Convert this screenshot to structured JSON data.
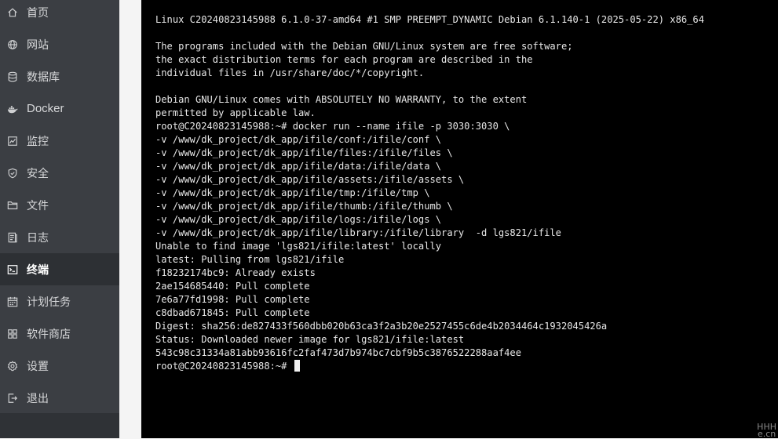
{
  "sidebar": {
    "items": [
      {
        "label": "首页",
        "icon": "home-icon",
        "active": false
      },
      {
        "label": "网站",
        "icon": "globe-icon",
        "active": false
      },
      {
        "label": "数据库",
        "icon": "database-icon",
        "active": false
      },
      {
        "label": "Docker",
        "icon": "docker-icon",
        "active": false
      },
      {
        "label": "监控",
        "icon": "monitor-icon",
        "active": false
      },
      {
        "label": "安全",
        "icon": "shield-icon",
        "active": false
      },
      {
        "label": "文件",
        "icon": "folder-icon",
        "active": false
      },
      {
        "label": "日志",
        "icon": "log-icon",
        "active": false
      },
      {
        "label": "终端",
        "icon": "terminal-icon",
        "active": true
      },
      {
        "label": "计划任务",
        "icon": "calendar-icon",
        "active": false
      },
      {
        "label": "软件商店",
        "icon": "apps-grid-icon",
        "active": false
      },
      {
        "label": "设置",
        "icon": "gear-icon",
        "active": false
      },
      {
        "label": "退出",
        "icon": "logout-icon",
        "active": false
      }
    ]
  },
  "terminal": {
    "lines": [
      "Linux C20240823145988 6.1.0-37-amd64 #1 SMP PREEMPT_DYNAMIC Debian 6.1.140-1 (2025-05-22) x86_64",
      "",
      "The programs included with the Debian GNU/Linux system are free software;",
      "the exact distribution terms for each program are described in the",
      "individual files in /usr/share/doc/*/copyright.",
      "",
      "Debian GNU/Linux comes with ABSOLUTELY NO WARRANTY, to the extent",
      "permitted by applicable law.",
      "root@C20240823145988:~# docker run --name ifile -p 3030:3030 \\",
      "-v /www/dk_project/dk_app/ifile/conf:/ifile/conf \\",
      "-v /www/dk_project/dk_app/ifile/files:/ifile/files \\",
      "-v /www/dk_project/dk_app/ifile/data:/ifile/data \\",
      "-v /www/dk_project/dk_app/ifile/assets:/ifile/assets \\",
      "-v /www/dk_project/dk_app/ifile/tmp:/ifile/tmp \\",
      "-v /www/dk_project/dk_app/ifile/thumb:/ifile/thumb \\",
      "-v /www/dk_project/dk_app/ifile/logs:/ifile/logs \\",
      "-v /www/dk_project/dk_app/ifile/library:/ifile/library  -d lgs821/ifile",
      "Unable to find image 'lgs821/ifile:latest' locally",
      "latest: Pulling from lgs821/ifile",
      "f18232174bc9: Already exists",
      "2ae154685440: Pull complete",
      "7e6a77fd1998: Pull complete",
      "c8dbad671845: Pull complete",
      "Digest: sha256:de827433f560dbb020b63ca3f2a3b20e2527455c6de4b2034464c1932045426a",
      "Status: Downloaded newer image for lgs821/ifile:latest",
      "543c98c31334a81abb93616fc2faf473d7b974bc7cbf9b5c3876522288aaf4ee"
    ],
    "prompt": "root@C20240823145988:~# "
  },
  "watermark": {
    "line1": "HHH",
    "line2": "e.cn"
  },
  "colors": {
    "sidebar_bg": "#3b3e43",
    "sidebar_active_bg": "#2d3034",
    "terminal_bg": "#000000",
    "terminal_fg": "#e8e8e8"
  }
}
